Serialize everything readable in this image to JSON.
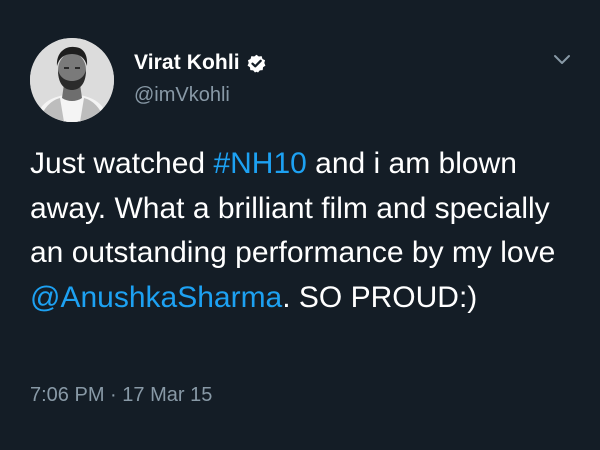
{
  "user": {
    "display_name": "Virat Kohli",
    "handle": "@imVkohli",
    "verified": true,
    "avatar": "profile-photo"
  },
  "tweet": {
    "text_segments": [
      {
        "text": "Just watched ",
        "type": "text"
      },
      {
        "text": "#NH10",
        "type": "hashtag"
      },
      {
        "text": " and i am blown away. What a brilliant film and specially an outstanding performance by my love ",
        "type": "text"
      },
      {
        "text": "@AnushkaSharma",
        "type": "mention"
      },
      {
        "text": ". SO PROUD:)",
        "type": "text"
      }
    ],
    "time": "7:06 PM",
    "separator": " · ",
    "date": "17 Mar 15"
  },
  "icons": {
    "verified": "verified-badge-icon",
    "menu": "chevron-down-icon"
  },
  "colors": {
    "background": "#141d26",
    "link": "#1da1f2",
    "secondary_text": "#8899a6",
    "primary_text": "#ffffff"
  }
}
